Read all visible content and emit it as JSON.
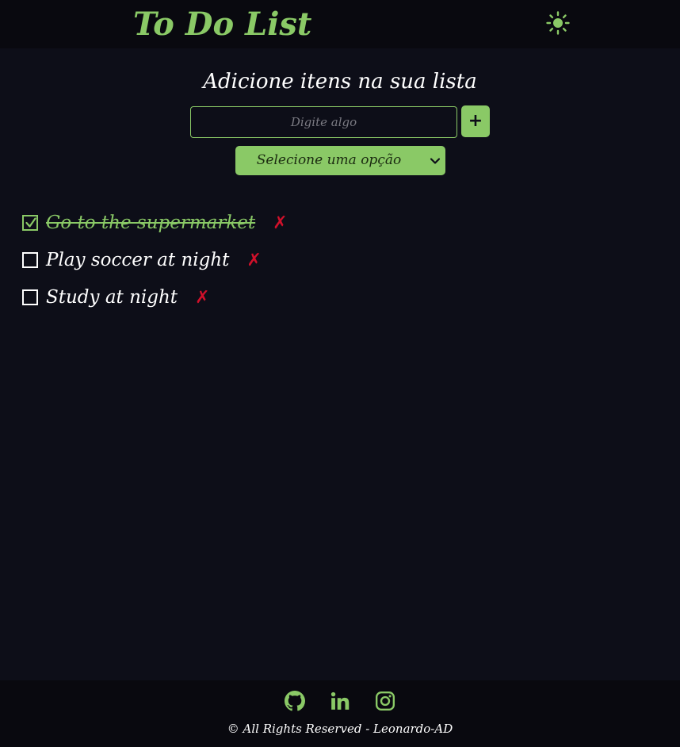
{
  "header": {
    "title": "To Do List",
    "theme_toggle_icon": "sun-icon"
  },
  "main": {
    "subtitle": "Adicione itens na sua lista",
    "input": {
      "value": "",
      "placeholder": "Digite algo"
    },
    "add_button_label": "+",
    "filter": {
      "selected": "Selecione uma opção"
    },
    "todos": [
      {
        "text": "Go to the supermarket",
        "done": true
      },
      {
        "text": "Play soccer at night",
        "done": false
      },
      {
        "text": "Study at night",
        "done": false
      }
    ],
    "delete_label": "✗"
  },
  "footer": {
    "social": [
      "github-icon",
      "linkedin-icon",
      "instagram-icon"
    ],
    "copyright": "© All Rights Reserved - Leonardo-AD"
  },
  "colors": {
    "background": "#0d0e18",
    "bar": "#09090f",
    "accent": "#8ac966",
    "danger": "#d0102a",
    "text": "#ffffff"
  }
}
